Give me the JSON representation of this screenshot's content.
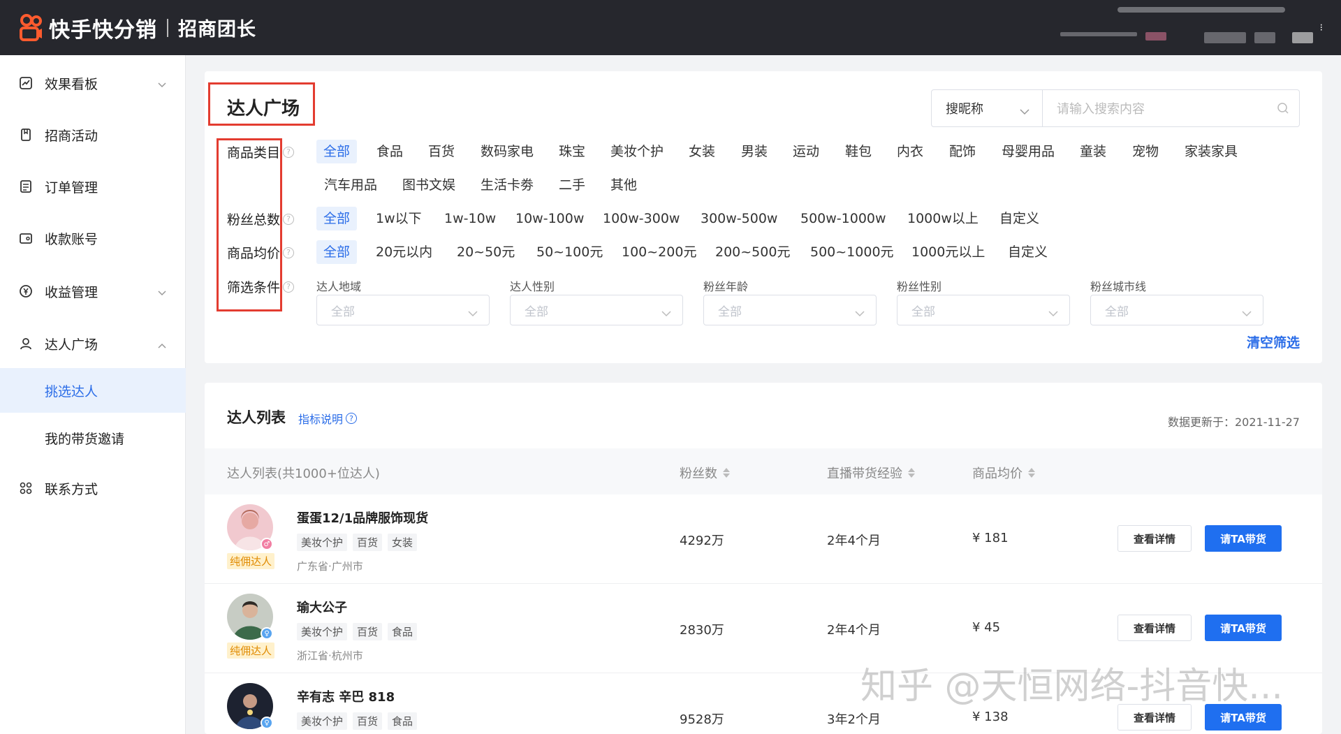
{
  "header": {
    "brand": "快手快分销",
    "subtitle": "招商团长"
  },
  "sidebar": {
    "items": [
      {
        "label": "效果看板",
        "icon": "chart-icon",
        "expandable": true
      },
      {
        "label": "招商活动",
        "icon": "bookmark-icon",
        "expandable": false
      },
      {
        "label": "订单管理",
        "icon": "list-icon",
        "expandable": false
      },
      {
        "label": "收款账号",
        "icon": "wallet-icon",
        "expandable": false
      },
      {
        "label": "收益管理",
        "icon": "yen-icon",
        "expandable": true
      },
      {
        "label": "达人广场",
        "icon": "user-icon",
        "expandable": true,
        "expanded": true
      }
    ],
    "subitems": [
      {
        "label": "挑选达人",
        "active": true
      },
      {
        "label": "我的带货邀请",
        "active": false
      }
    ],
    "contact": {
      "label": "联系方式",
      "icon": "grid-icon"
    }
  },
  "filters": {
    "title": "达人广场",
    "search_type": "搜昵称",
    "search_placeholder": "请输入搜索内容",
    "category": {
      "label": "商品类目",
      "options": [
        "全部",
        "食品",
        "百货",
        "数码家电",
        "珠宝",
        "美妆个护",
        "女装",
        "男装",
        "运动",
        "鞋包",
        "内衣",
        "配饰",
        "母婴用品",
        "童装",
        "宠物",
        "家装家具"
      ],
      "options_row2": [
        "汽车用品",
        "图书文娱",
        "生活卡劵",
        "二手",
        "其他"
      ]
    },
    "fans": {
      "label": "粉丝总数",
      "options": [
        "全部",
        "1w以下",
        "1w-10w",
        "10w-100w",
        "100w-300w",
        "300w-500w",
        "500w-1000w",
        "1000w以上",
        "自定义"
      ]
    },
    "price": {
      "label": "商品均价",
      "options": [
        "全部",
        "20元以内",
        "20~50元",
        "50~100元",
        "100~200元",
        "200~500元",
        "500~1000元",
        "1000元以上",
        "自定义"
      ]
    },
    "conditions": {
      "label": "筛选条件",
      "dropdowns": [
        {
          "label": "达人地域",
          "value": "全部"
        },
        {
          "label": "达人性别",
          "value": "全部"
        },
        {
          "label": "粉丝年龄",
          "value": "全部"
        },
        {
          "label": "粉丝性别",
          "value": "全部"
        },
        {
          "label": "粉丝城市线",
          "value": "全部"
        }
      ]
    },
    "clear": "清空筛选"
  },
  "list": {
    "title": "达人列表",
    "metric_link": "指标说明",
    "updated": "数据更新于：2021-11-27",
    "columns": {
      "kol": "达人列表(共1000+位达人)",
      "fans": "粉丝数",
      "experience": "直播带货经验",
      "avg_price": "商品均价"
    },
    "rows": [
      {
        "name": "蛋蛋12/1品牌服饰现货",
        "badge": "纯佣达人",
        "tags": [
          "美妆个护",
          "百货",
          "女装"
        ],
        "location": "广东省·广州市",
        "fans": "4292万",
        "experience": "2年4个月",
        "avg_price": "¥ 181",
        "gender": "female"
      },
      {
        "name": "瑜大公子",
        "badge": "纯佣达人",
        "tags": [
          "美妆个护",
          "百货",
          "食品"
        ],
        "location": "浙江省·杭州市",
        "fans": "2830万",
        "experience": "2年4个月",
        "avg_price": "¥ 45",
        "gender": "male"
      },
      {
        "name": "辛有志 辛巴 818",
        "badge": "",
        "tags": [
          "美妆个护",
          "百货",
          "食品"
        ],
        "location": "",
        "fans": "9528万",
        "experience": "3年2个月",
        "avg_price": "¥ 138",
        "gender": "male"
      }
    ],
    "detail_button": "查看详情",
    "invite_button": "请TA带货"
  },
  "watermark": "知乎 @天恒网络-抖音快...",
  "colors": {
    "accent": "#2b6de8",
    "primary_button": "#1f6ff0",
    "highlight_box": "#e33c30",
    "topbar": "#26272d",
    "brand_orange": "#ff5b2e",
    "badge_bg": "#fff1cc"
  }
}
